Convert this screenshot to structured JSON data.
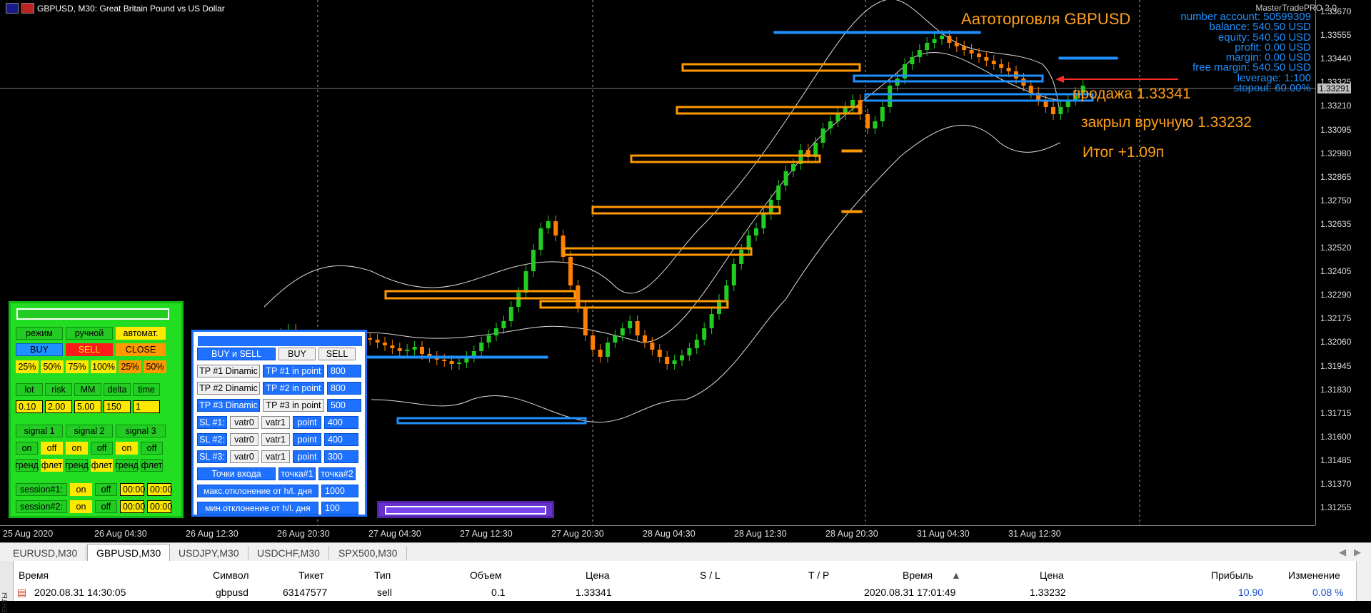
{
  "window": {
    "title": "GBPUSD, M30:  Great Britain Pound vs US Dollar"
  },
  "overlay": {
    "brand": "MasterTradePRO 2.0",
    "heading": "Аатоторговля GBPUSD",
    "notes": [
      "продажа 1.33341",
      "закрыл вручную 1.33232",
      "Итог +1.09п"
    ],
    "account": [
      "number account: 50599309",
      "balance: 540.50 USD",
      "equity: 540.50 USD",
      "profit: 0.00 USD",
      "margin: 0.00 USD",
      "free margin: 540.50 USD",
      "leverage: 1:100",
      "stopout: 60.00%"
    ]
  },
  "price_axis": [
    "1.33670",
    "1.33555",
    "1.33440",
    "1.33325",
    "1.33210",
    "1.33095",
    "1.32980",
    "1.32865",
    "1.32750",
    "1.32635",
    "1.32520",
    "1.32405",
    "1.32290",
    "1.32175",
    "1.32060",
    "1.31945",
    "1.31830",
    "1.31715",
    "1.31600",
    "1.31485",
    "1.31370",
    "1.31255"
  ],
  "current_price": "1.33291",
  "time_axis": [
    "25 Aug 2020",
    "26 Aug 04:30",
    "26 Aug 12:30",
    "26 Aug 20:30",
    "27 Aug 04:30",
    "27 Aug 12:30",
    "27 Aug 20:30",
    "28 Aug 04:30",
    "28 Aug 12:30",
    "28 Aug 20:30",
    "31 Aug 04:30",
    "31 Aug 12:30"
  ],
  "colors": {
    "bull": "#22cc22",
    "bear": "#ff7f00",
    "zone_orange": "#ff9900",
    "zone_blue": "#1e90ff",
    "accent_text": "#ff9f1a",
    "account_text": "#1e90ff"
  },
  "panel_left": {
    "mode_row": [
      "режим",
      "ручной",
      "автомат."
    ],
    "trade_row": [
      "BUY",
      "SELL",
      "CLOSE"
    ],
    "pct_row": [
      "25%",
      "50%",
      "75%",
      "100%",
      "25%",
      "50%"
    ],
    "param_labels": [
      "lot",
      "risk",
      "MM",
      "delta",
      "time"
    ],
    "param_values": [
      "0.10",
      "2.00",
      "5.00",
      "150",
      "1"
    ],
    "signal_labels": [
      "signal 1",
      "signal 2",
      "signal 3"
    ],
    "onoff_row": [
      "on",
      "off",
      "on",
      "off",
      "on",
      "off"
    ],
    "trend_row": [
      "гренд",
      "флет",
      "гренд",
      "флет",
      "гренд",
      "флет"
    ],
    "session1": {
      "label": "session#1:",
      "on": "on",
      "off": "off",
      "t1": "00:00",
      "t2": "00:00"
    },
    "session2": {
      "label": "session#2:",
      "on": "on",
      "off": "off",
      "t1": "00:00",
      "t2": "00:00"
    }
  },
  "panel_right": {
    "top_row": [
      "BUY и SELL",
      "BUY",
      "SELL"
    ],
    "tp_rows": [
      {
        "mode": "TP #1 Dinamic",
        "label": "TP #1 in point",
        "value": "800"
      },
      {
        "mode": "TP #2 Dinamic",
        "label": "TP #2 in point",
        "value": "800"
      },
      {
        "mode": "TP #3 Dinamic",
        "label": "TP #3 in point",
        "value": "500"
      }
    ],
    "sl_rows": [
      {
        "label": "SL #1:",
        "v0": "vatr0",
        "v1": "vatr1",
        "unit": "point",
        "value": "400"
      },
      {
        "label": "SL #2:",
        "v0": "vatr0",
        "v1": "vatr1",
        "unit": "point",
        "value": "400"
      },
      {
        "label": "SL #3:",
        "v0": "vatr0",
        "v1": "vatr1",
        "unit": "point",
        "value": "300"
      }
    ],
    "entry_row": [
      "Точки входа",
      "точка#1",
      "точка#2"
    ],
    "max_dev": {
      "label": "макс.отклонение от h/l. дня",
      "value": "1000"
    },
    "min_dev": {
      "label": "мин.отклонение от h/l. дня",
      "value": "100"
    }
  },
  "tabs": [
    "EURUSD,M30",
    "GBPUSD,M30",
    "USDJPY,M30",
    "USDCHF,M30",
    "SPX500,M30"
  ],
  "active_tab": "GBPUSD,M30",
  "side_label": "ЕНТЫ",
  "table": {
    "headers": [
      "Время",
      "Символ",
      "Тикет",
      "Тип",
      "Объем",
      "Цена",
      "S / L",
      "T / P",
      "Время",
      "Цена",
      "Прибыль",
      "Изменение"
    ],
    "rows": [
      [
        "2020.08.31 14:30:05",
        "gbpusd",
        "63147577",
        "sell",
        "0.1",
        "1.33341",
        "",
        "",
        "2020.08.31 17:01:49",
        "1.33232",
        "10.90",
        "0.08 %"
      ]
    ]
  }
}
